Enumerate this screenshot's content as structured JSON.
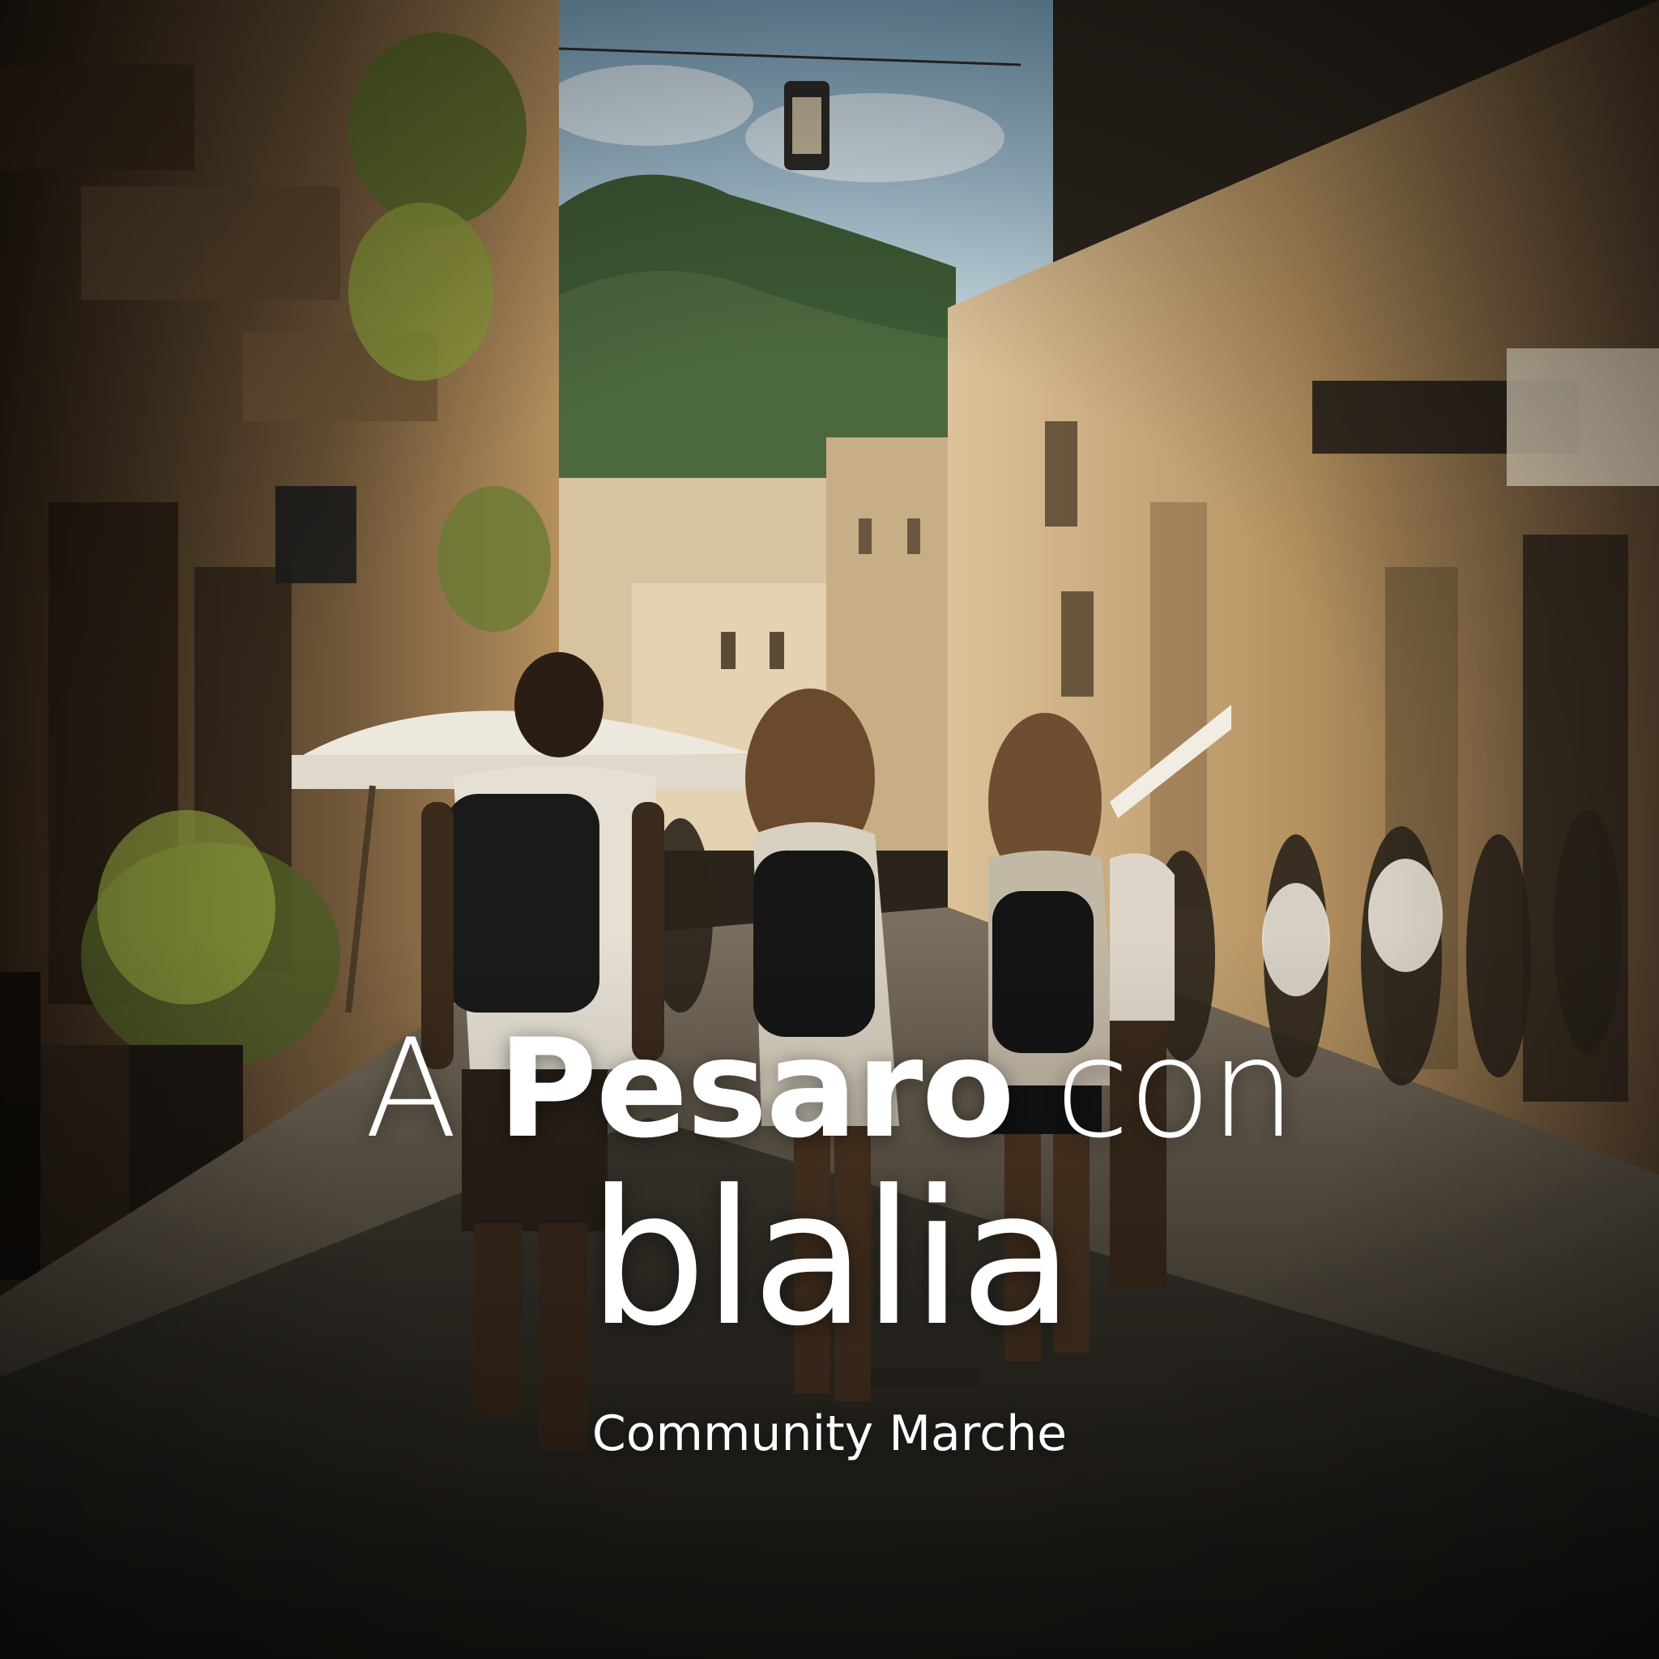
{
  "headline": {
    "word_1": "A",
    "word_2": "Pesaro",
    "word_3": "con"
  },
  "brand": "blalia",
  "tagline": "Community Marche",
  "colors": {
    "text": "#ffffff",
    "sky": "#8fb4c9",
    "hill": "#3f5a36",
    "facade_warm": "#c8a574",
    "street": "#3a352e"
  }
}
